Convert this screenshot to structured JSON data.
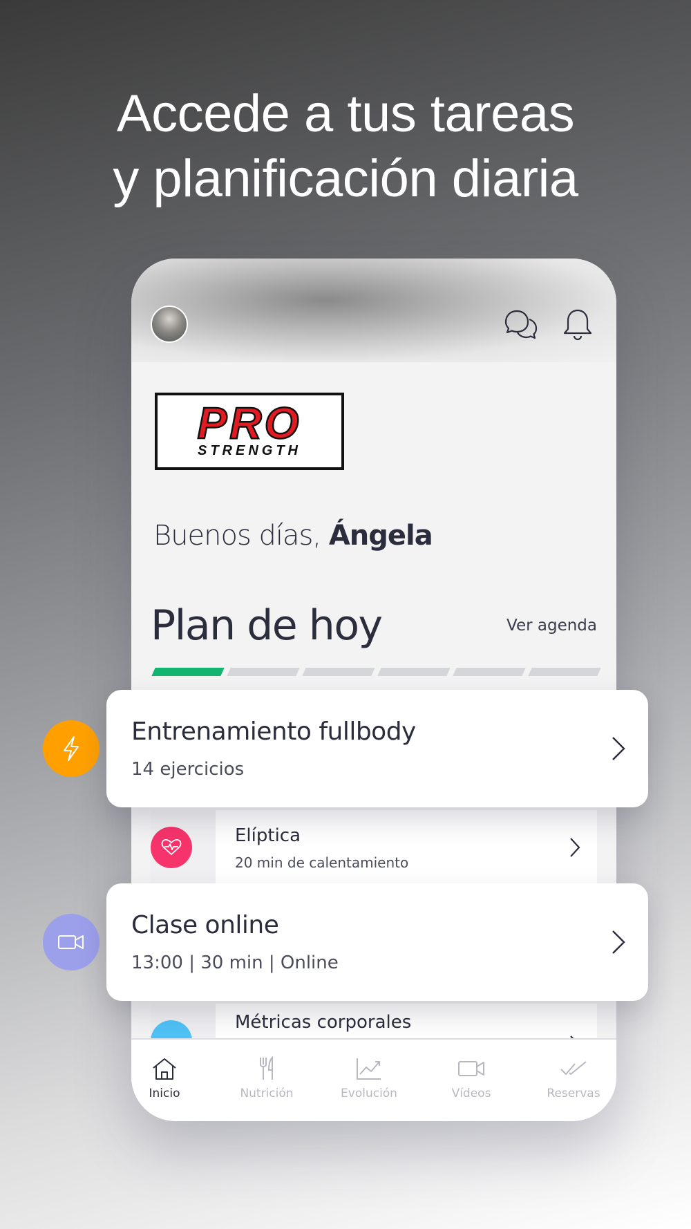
{
  "headline": {
    "line1": "Accede a tus tareas",
    "line2": "y planificación diaria"
  },
  "header": {
    "logo_text_top": "PRO",
    "logo_text_bottom": "STRENGTH"
  },
  "greeting": {
    "prefix": "Buenos días,",
    "name": "Ángela"
  },
  "plan": {
    "title": "Plan de hoy",
    "agenda_link": "Ver agenda",
    "segments_total": 6,
    "segments_done": 1
  },
  "cards": [
    {
      "title": "Entrenamiento fullbody",
      "subtitle": "14 ejercicios",
      "icon": "lightning-icon",
      "icon_color": "#FFA000"
    },
    {
      "title": "Clase online",
      "subtitle": "13:00 | 30 min | Online",
      "icon": "video-camera-icon",
      "icon_color": "#9C9FEA"
    }
  ],
  "rows": [
    {
      "title": "Elíptica",
      "subtitle": "20 min de calentamiento",
      "icon": "heart-rate-icon",
      "icon_color": "#F7336B"
    },
    {
      "title": "Métricas corporales",
      "subtitle": "",
      "icon": "metrics-icon",
      "icon_color": "#4FC3F7"
    }
  ],
  "tabbar": [
    {
      "label": "Inicio",
      "icon": "home-icon",
      "active": true
    },
    {
      "label": "Nutrición",
      "icon": "cutlery-icon",
      "active": false
    },
    {
      "label": "Evolución",
      "icon": "chart-icon",
      "active": false
    },
    {
      "label": "Vídeos",
      "icon": "video-icon",
      "active": false
    },
    {
      "label": "Reservas",
      "icon": "double-check-icon",
      "active": false
    }
  ],
  "colors": {
    "progress_done": "#11B56F",
    "progress_todo": "#D5D6DA",
    "text_dark": "#2B2D3D"
  }
}
